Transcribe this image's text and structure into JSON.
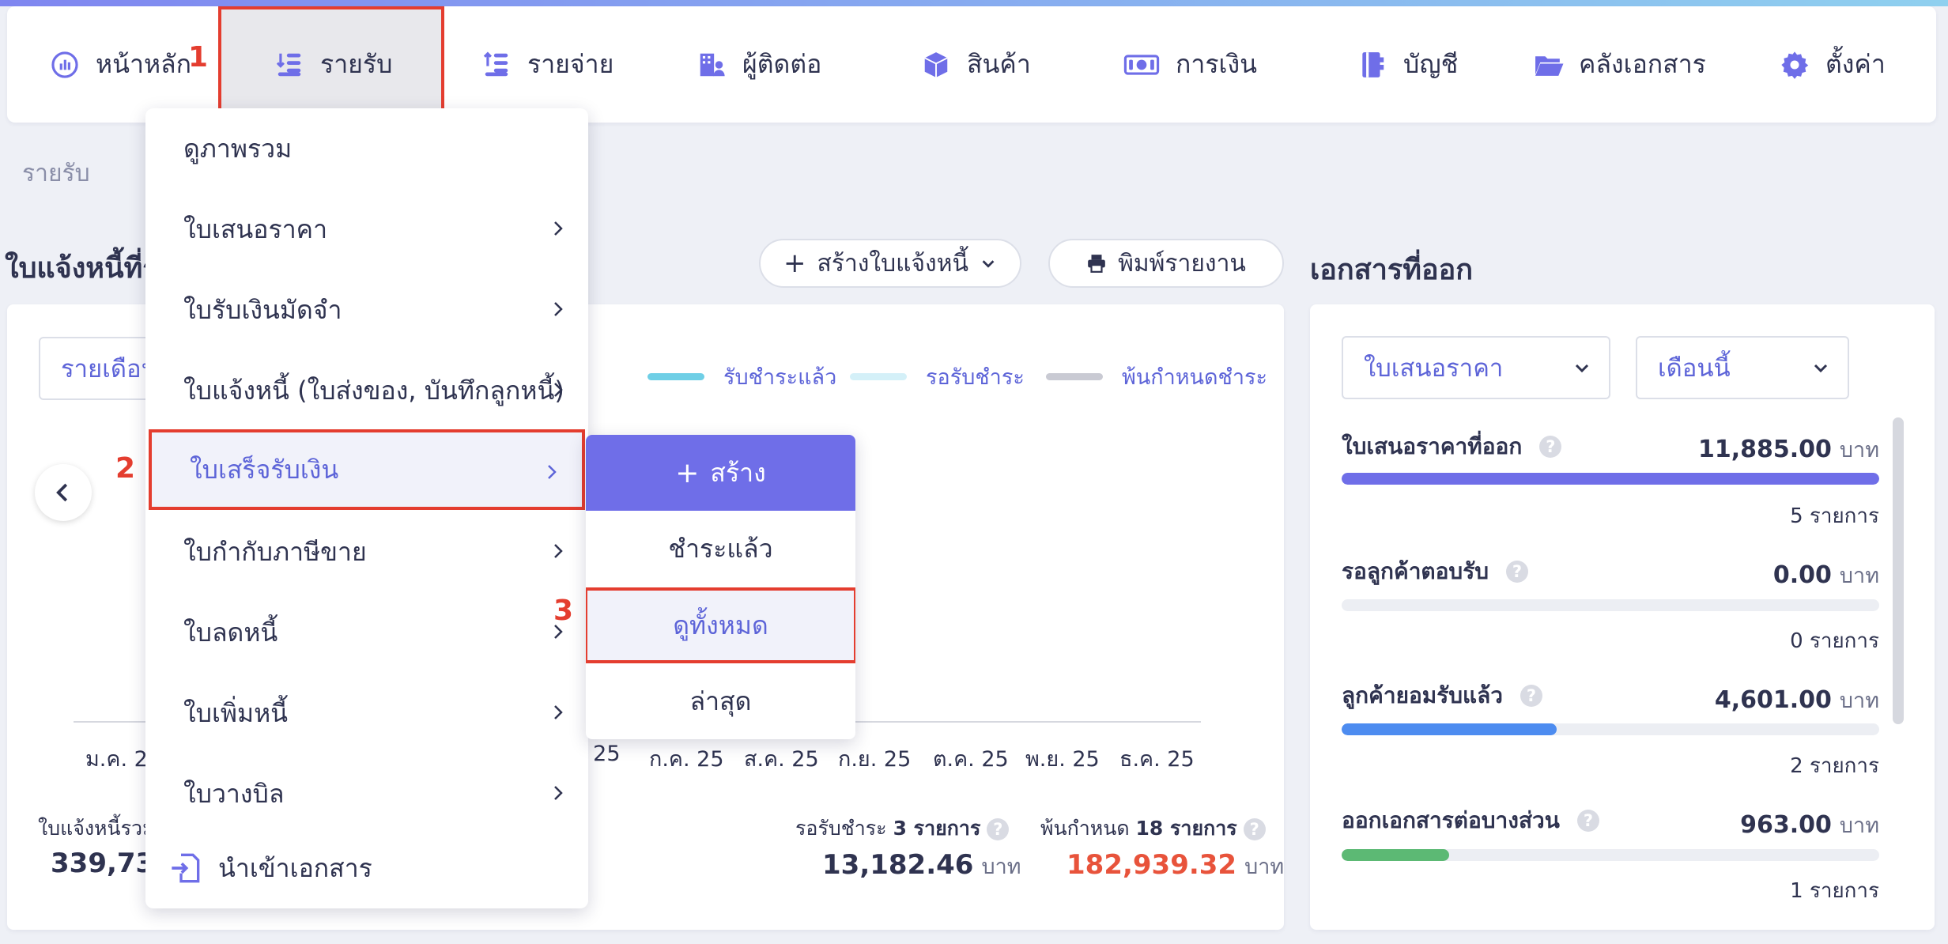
{
  "nav": {
    "items": [
      {
        "label": "หน้าหลัก",
        "icon": "chart-circle-icon"
      },
      {
        "label": "รายรับ",
        "icon": "income-stack-icon"
      },
      {
        "label": "รายจ่าย",
        "icon": "expense-stack-icon"
      },
      {
        "label": "ผู้ติดต่อ",
        "icon": "building-person-icon"
      },
      {
        "label": "สินค้า",
        "icon": "box-icon"
      },
      {
        "label": "การเงิน",
        "icon": "money-icon"
      },
      {
        "label": "บัญชี",
        "icon": "ledger-book-icon"
      },
      {
        "label": "คลังเอกสาร",
        "icon": "folder-open-icon"
      },
      {
        "label": "ตั้งค่า",
        "icon": "gear-icon"
      }
    ],
    "active_index": 1
  },
  "steps": {
    "one": "1",
    "two": "2",
    "three": "3"
  },
  "breadcrumb": "รายรับ",
  "left": {
    "title": "ใบแจ้งหนี้ที่รั",
    "create_button": "สร้างใบแจ้งหนี้",
    "print_button": "พิมพ์รายงาน",
    "period_select": "รายเดือน",
    "legend": [
      {
        "label": "รับชำระแล้ว",
        "color": "#6fcfe6"
      },
      {
        "label": "รอรับชำระ",
        "color": "#d4f0f8"
      },
      {
        "label": "พ้นกำหนดชำระ",
        "color": "#c9cad3"
      }
    ],
    "x_ticks": [
      "ม.ค. 25",
      ". 25",
      "ก.ค. 25",
      "ส.ค. 25",
      "ก.ย. 25",
      "ต.ค. 25",
      "พ.ย. 25",
      "ธ.ค. 25"
    ],
    "total_label": "ใบแจ้งหนี้รวม",
    "total_value": "339,732",
    "pending_label": "รอรับชำระ",
    "pending_count": "3 รายการ",
    "pending_value": "13,182.46",
    "overdue_label": "พ้นกำหนด",
    "overdue_count": "18 รายการ",
    "overdue_value": "182,939.32",
    "unit": "บาท",
    "help": "?"
  },
  "menu": {
    "items": [
      {
        "label": "ดูภาพรวม",
        "has_arrow": false
      },
      {
        "label": "ใบเสนอราคา",
        "has_arrow": true
      },
      {
        "label": "ใบรับเงินมัดจำ",
        "has_arrow": true
      },
      {
        "label": "ใบแจ้งหนี้ (ใบส่งของ, บันทึกลูกหนี้)",
        "has_arrow": true
      },
      {
        "label": "ใบเสร็จรับเงิน",
        "has_arrow": true
      },
      {
        "label": "ใบกำกับภาษีขาย",
        "has_arrow": true
      },
      {
        "label": "ใบลดหนี้",
        "has_arrow": true
      },
      {
        "label": "ใบเพิ่มหนี้",
        "has_arrow": true
      },
      {
        "label": "ใบวางบิล",
        "has_arrow": true
      },
      {
        "label": "นำเข้าเอกสาร",
        "has_arrow": false
      }
    ]
  },
  "submenu": {
    "create": "สร้าง",
    "paid": "ชำระแล้ว",
    "view_all": "ดูทั้งหมด",
    "latest": "ล่าสุด"
  },
  "right": {
    "title": "เอกสารที่ออก",
    "doc_select": "ใบเสนอราคา",
    "period_select": "เดือนนี้",
    "rows": [
      {
        "title": "ใบเสนอราคาที่ออก",
        "amount": "11,885.00",
        "count": "5 รายการ",
        "fill": 1.0,
        "color": "#6f6ee8"
      },
      {
        "title": "รอลูกค้าตอบรับ",
        "amount": "0.00",
        "count": "0 รายการ",
        "fill": 0.0,
        "color": "#6f6ee8"
      },
      {
        "title": "ลูกค้ายอมรับแล้ว",
        "amount": "4,601.00",
        "count": "2 รายการ",
        "fill": 0.4,
        "color": "#4d8cf0"
      },
      {
        "title": "ออกเอกสารต่อบางส่วน",
        "amount": "963.00",
        "count": "1 รายการ",
        "fill": 0.2,
        "color": "#5cb974"
      }
    ],
    "unit": "บาท"
  }
}
